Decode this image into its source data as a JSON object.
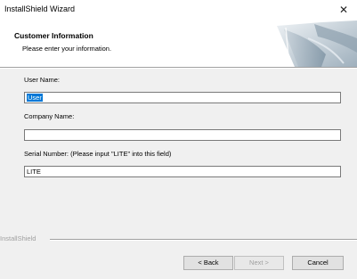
{
  "window": {
    "title": "InstallShield Wizard",
    "close_icon": "close-icon"
  },
  "header": {
    "title": "Customer Information",
    "subtitle": "Please enter your information."
  },
  "form": {
    "user_name_label": "User Name:",
    "user_name_value": "User",
    "company_name_label": "Company Name:",
    "company_name_value": "",
    "serial_label": "Serial Number:  (Please input \"LITE\" into this field)",
    "serial_value": "LITE"
  },
  "footer": {
    "brand": "InstallShield",
    "back_label": "< Back",
    "next_label": "Next >",
    "cancel_label": "Cancel"
  }
}
